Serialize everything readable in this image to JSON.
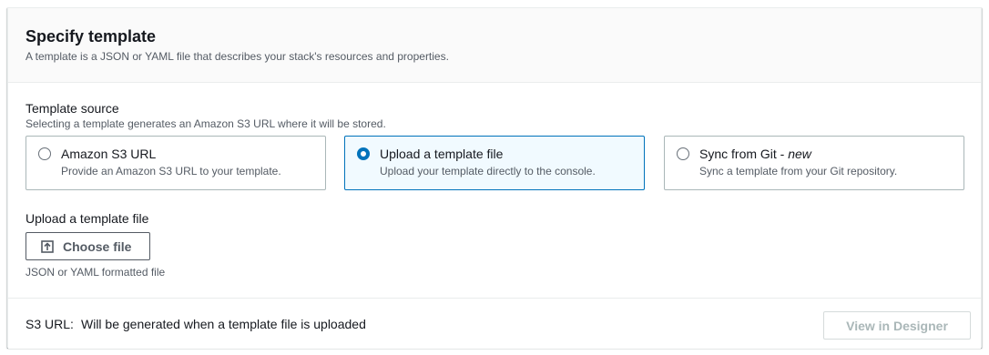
{
  "header": {
    "title": "Specify template",
    "description": "A template is a JSON or YAML file that describes your stack's resources and properties."
  },
  "template_source": {
    "label": "Template source",
    "description": "Selecting a template generates an Amazon S3 URL where it will be stored.",
    "options": [
      {
        "label": "Amazon S3 URL",
        "label_suffix": "",
        "description": "Provide an Amazon S3 URL to your template.",
        "selected": false
      },
      {
        "label": "Upload a template file",
        "label_suffix": "",
        "description": "Upload your template directly to the console.",
        "selected": true
      },
      {
        "label": "Sync from Git - ",
        "label_suffix": "new",
        "description": "Sync a template from your Git repository.",
        "selected": false
      }
    ]
  },
  "upload": {
    "label": "Upload a template file",
    "button_label": "Choose file",
    "button_icon": "upload-icon",
    "hint": "JSON or YAML formatted file"
  },
  "footer": {
    "s3_label": "S3 URL:",
    "s3_value": "Will be generated when a template file is uploaded",
    "designer_button_label": "View in Designer",
    "designer_button_disabled": true
  },
  "colors": {
    "accent": "#0073bb",
    "selected_bg": "#f1faff",
    "header_bg": "#fafafa",
    "text_primary": "#16191f",
    "text_secondary": "#545b64",
    "disabled_text": "#aab7b8"
  }
}
